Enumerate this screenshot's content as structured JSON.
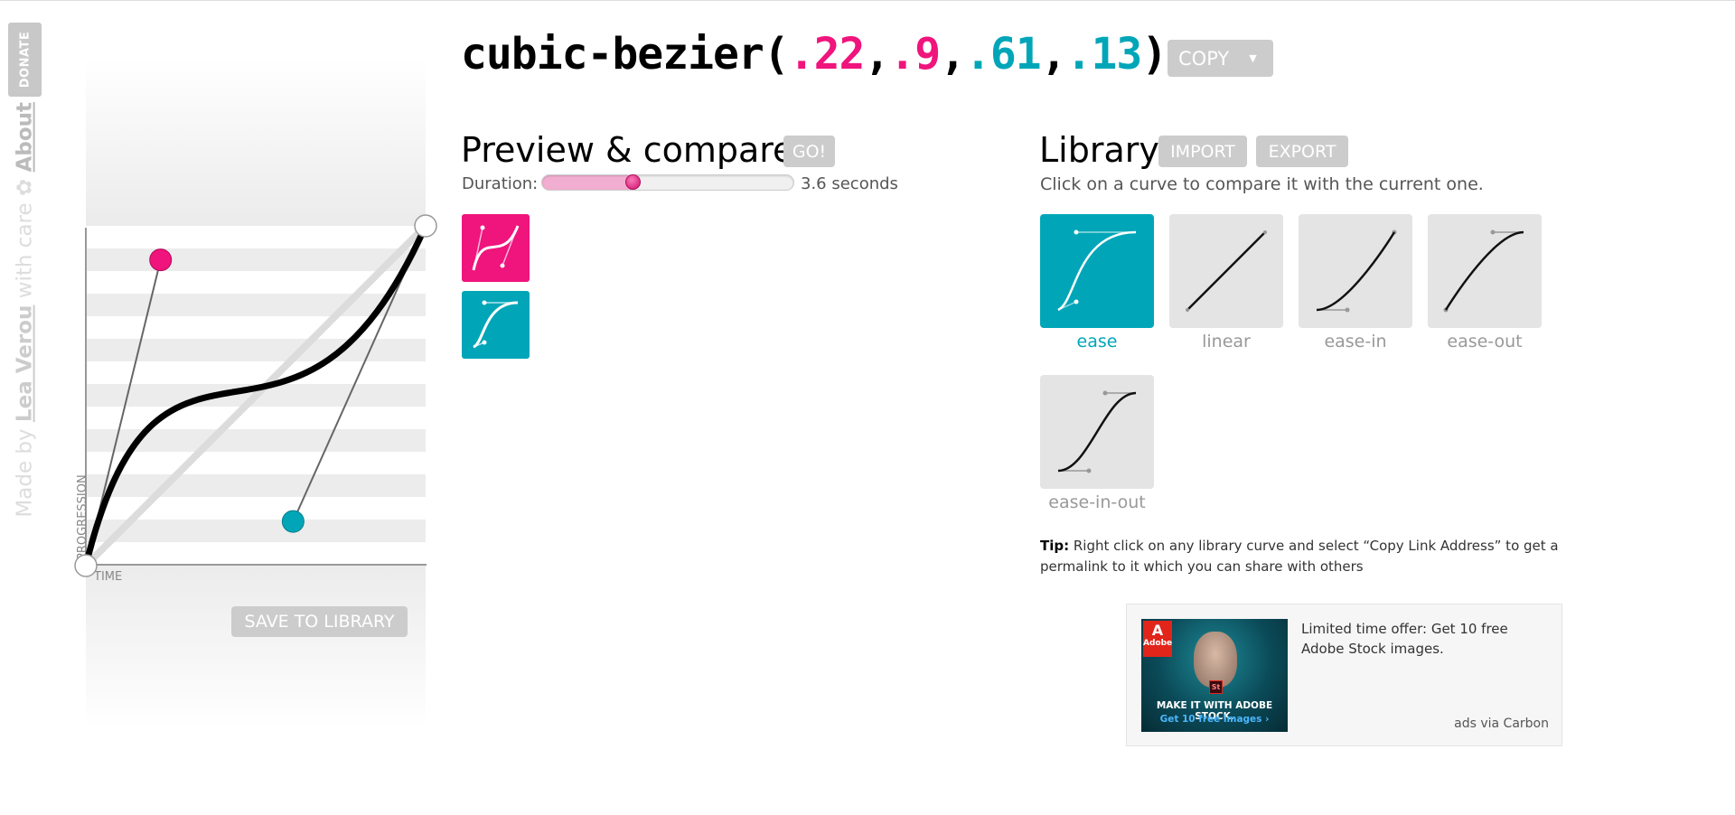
{
  "side": {
    "donate_label": "DONATE",
    "credit_prefix": "Made by ",
    "credit_author": "Lea Verou",
    "credit_suffix": " with care ",
    "about_label": "About"
  },
  "editor": {
    "y_label": "PROGRESSION",
    "x_label": "TIME",
    "save_label": "SAVE TO LIBRARY",
    "p1": [
      0.22,
      0.9
    ],
    "p2": [
      0.61,
      0.13
    ],
    "colors": {
      "p1": "#f0147d",
      "p2": "#00a6b8",
      "curve": "#000000"
    }
  },
  "title": {
    "prefix": "cubic-bezier(",
    "x1": ".22",
    "y1": ".9",
    "x2": ".61",
    "y2": ".13",
    "comma": ",",
    "suffix": ")",
    "copy_label": "COPY",
    "copy_caret": "▼"
  },
  "preview": {
    "heading": "Preview & compare",
    "go_label": "GO!",
    "duration_label": "Duration:",
    "duration_fraction": 0.36,
    "duration_value": "3.6 seconds",
    "items": [
      {
        "name": "current",
        "color": "#f0147d"
      },
      {
        "name": "ease",
        "color": "#00a6b8"
      }
    ]
  },
  "library": {
    "heading": "Library",
    "import_label": "IMPORT",
    "export_label": "EXPORT",
    "subtitle": "Click on a curve to compare it with the current one.",
    "items": [
      {
        "label": "ease",
        "active": true
      },
      {
        "label": "linear",
        "active": false
      },
      {
        "label": "ease-in",
        "active": false
      },
      {
        "label": "ease-out",
        "active": false
      },
      {
        "label": "ease-in-out",
        "active": false
      }
    ],
    "tip_label": "Tip:",
    "tip_text": " Right click on any library curve and select “Copy Link Address” to get a permalink to it which you can share with others"
  },
  "ad": {
    "logo_text": "Adobe",
    "badge": "St",
    "image_line1": "MAKE IT WITH ADOBE STOCK.",
    "image_line2": "Get 10 free images ›",
    "text": "Limited time offer: Get 10 free Adobe Stock images.",
    "via": "ads via Carbon"
  }
}
